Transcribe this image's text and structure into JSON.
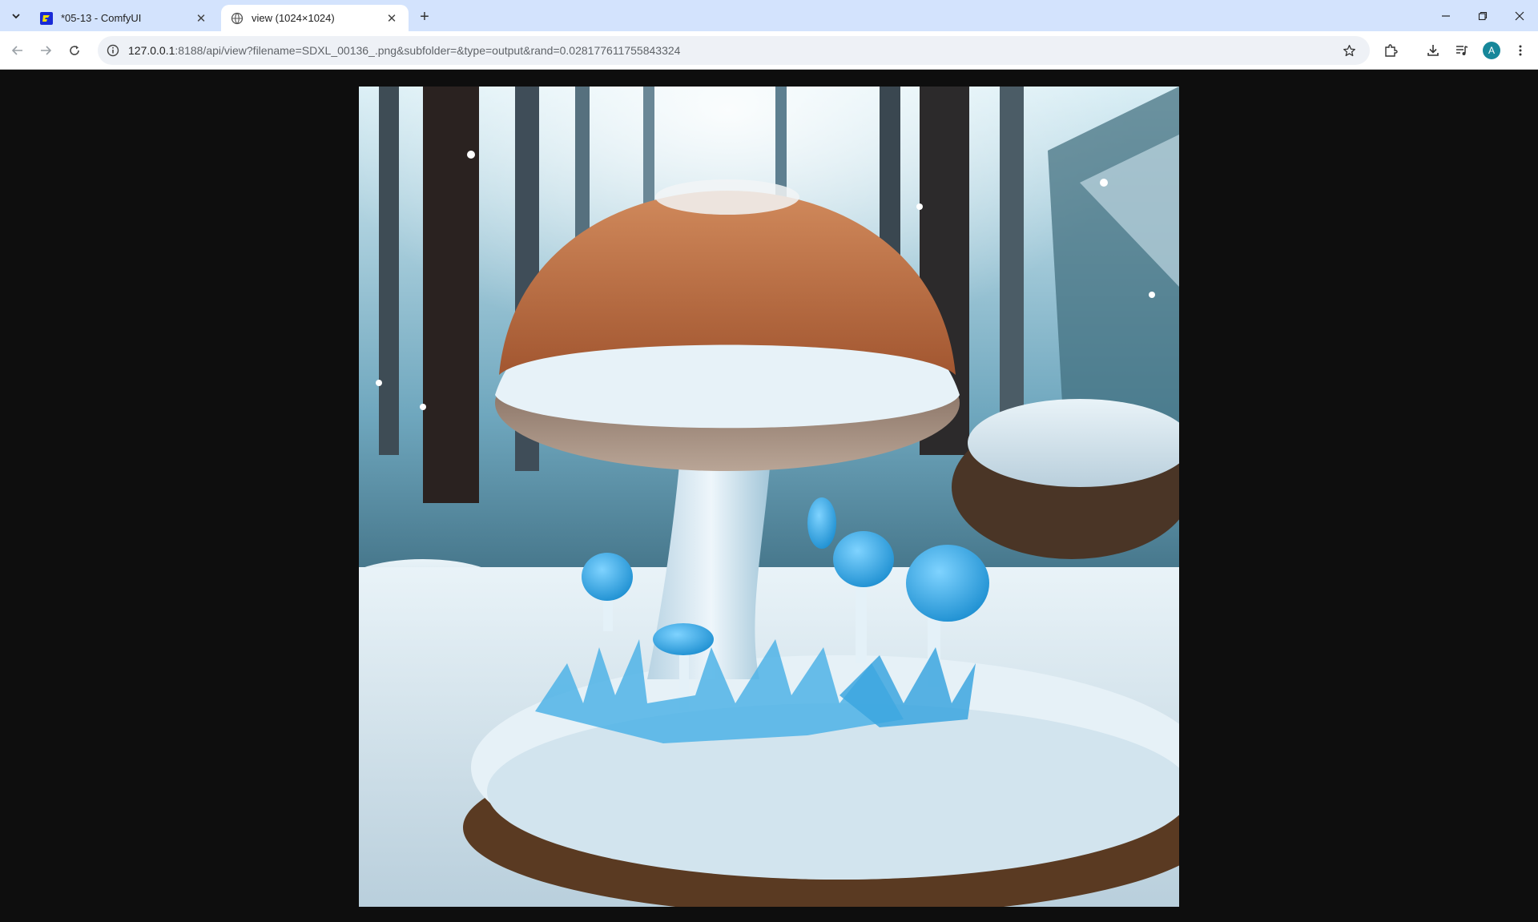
{
  "tabs": [
    {
      "title": "*05-13 - ComfyUI",
      "favicon": "comfyui-logo-icon",
      "active": false
    },
    {
      "title": "view (1024×1024)",
      "favicon": "globe-icon",
      "active": true
    }
  ],
  "address_bar": {
    "host": "127.0.0.1",
    "rest": ":8188/api/view?filename=SDXL_00136_.png&subfolder=&type=output&rand=0.028177611755843324"
  },
  "profile": {
    "initial": "A",
    "color": "#16879a"
  },
  "image": {
    "description_icon": "generated-image",
    "width_px_label": "1024",
    "height_px_label": "1024"
  },
  "colors": {
    "tabstrip": "#d3e3fd",
    "page_background": "#0e0e0e"
  }
}
